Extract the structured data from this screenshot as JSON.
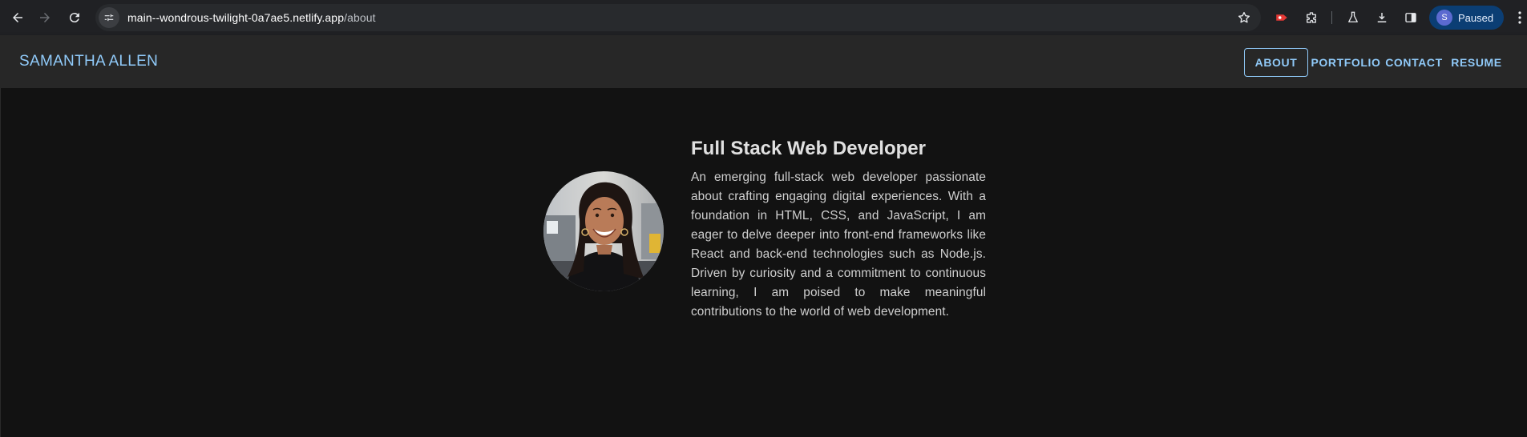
{
  "browser": {
    "url_host": "main--wondrous-twilight-0a7ae5.netlify.app",
    "url_path": "/about",
    "profile_initial": "S",
    "profile_status": "Paused"
  },
  "site": {
    "brand": "SAMANTHA ALLEN",
    "nav": [
      {
        "label": "ABOUT",
        "active": true
      },
      {
        "label": "PORTFOLIO",
        "active": false
      },
      {
        "label": "CONTACT",
        "active": false
      },
      {
        "label": "RESUME",
        "active": false
      }
    ]
  },
  "about": {
    "headline": "Full Stack Web Developer",
    "bio": "An emerging full-stack web developer passionate about crafting engaging digital experiences. With a foundation in HTML, CSS, and JavaScript, I am eager to delve deeper into front-end frameworks like React and back-end technologies such as Node.js. Driven by curiosity and a commitment to continuous learning, I am poised to make meaningful contributions to the world of web development."
  },
  "colors": {
    "accent": "#90caf9",
    "background": "#121212",
    "header": "#272727"
  }
}
